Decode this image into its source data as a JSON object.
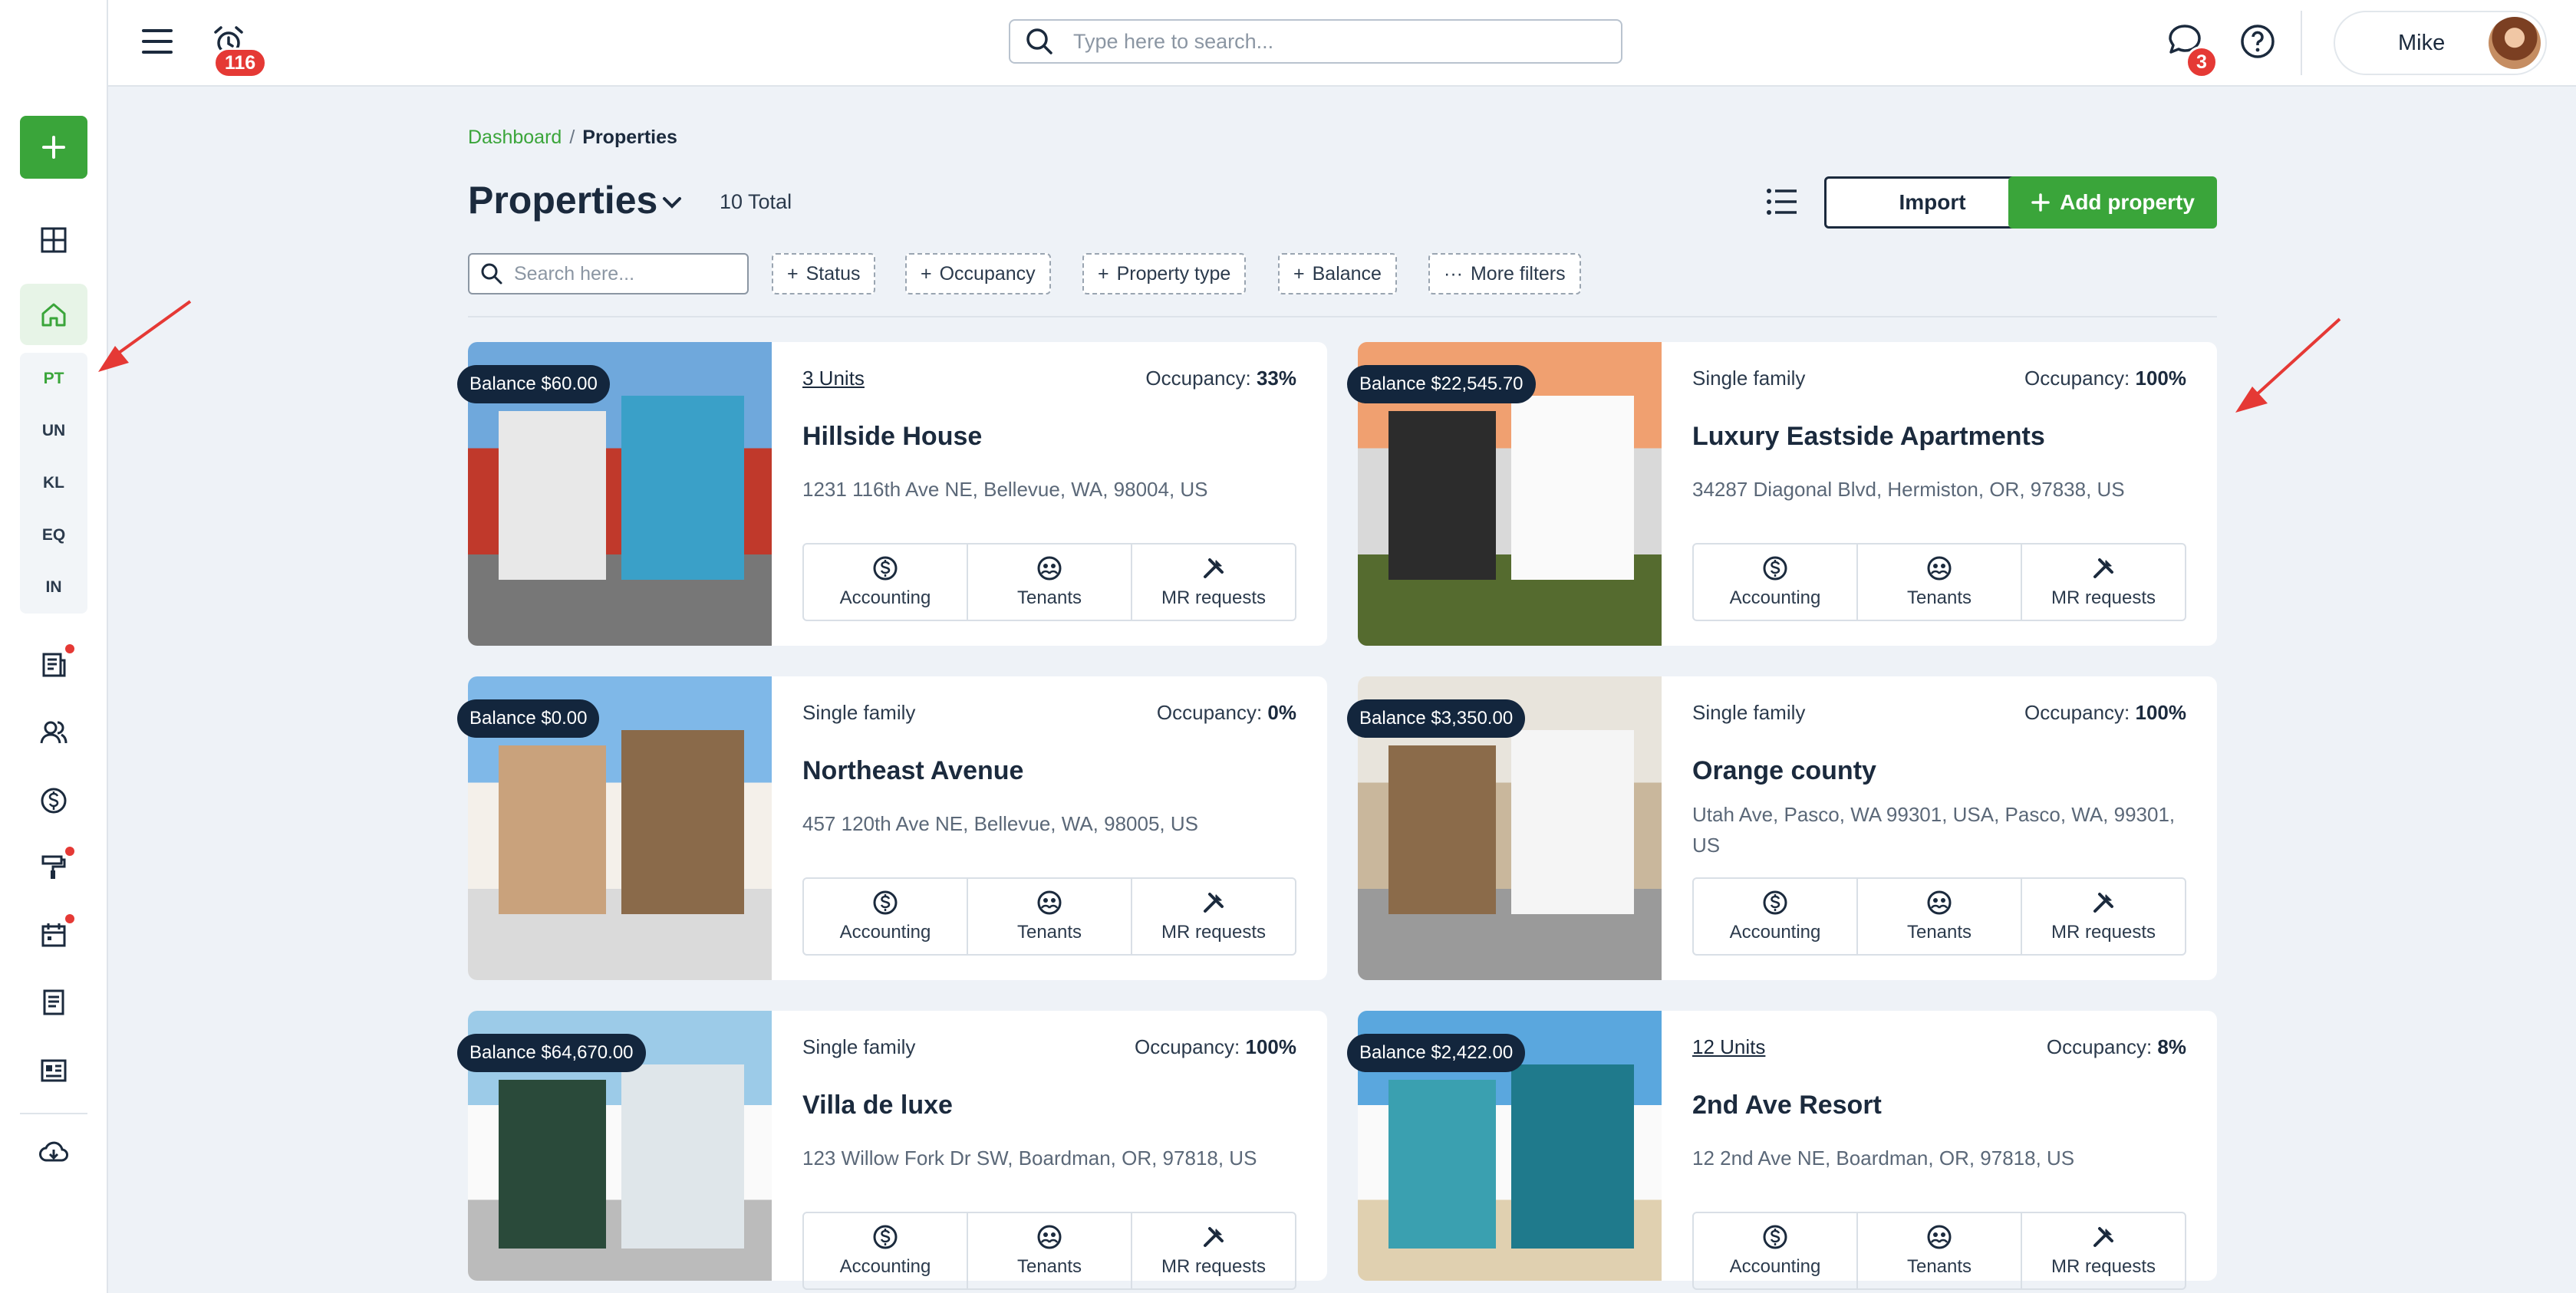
{
  "topbar": {
    "notifications_count": "116",
    "search_placeholder": "Type here to search...",
    "messages_count": "3",
    "user_name": "Mike"
  },
  "sidebar": {
    "sub_items": [
      "PT",
      "UN",
      "KL",
      "EQ",
      "IN"
    ]
  },
  "breadcrumb": {
    "root": "Dashboard",
    "separator": "/",
    "current": "Properties"
  },
  "page": {
    "title": "Properties",
    "total": "10 Total",
    "import_label": "Import",
    "add_label": "Add property"
  },
  "filters": {
    "search_placeholder": "Search here...",
    "chips": [
      "Status",
      "Occupancy",
      "Property type",
      "Balance",
      "More filters"
    ]
  },
  "action_labels": {
    "accounting": "Accounting",
    "tenants": "Tenants",
    "mr": "MR requests"
  },
  "occupancy_label": "Occupancy:",
  "properties": [
    {
      "balance": "Balance $60.00",
      "type": "3 Units",
      "type_link": true,
      "occupancy": "33%",
      "name": "Hillside House",
      "address": "1231 116th Ave NE, Bellevue, WA, 98004, US"
    },
    {
      "balance": "Balance $22,545.70",
      "type": "Single family",
      "type_link": false,
      "occupancy": "100%",
      "name": "Luxury Eastside Apartments",
      "address": "34287 Diagonal Blvd, Hermiston, OR, 97838, US"
    },
    {
      "balance": "Balance $0.00",
      "type": "Single family",
      "type_link": false,
      "occupancy": "0%",
      "name": "Northeast Avenue",
      "address": "457 120th Ave NE, Bellevue, WA, 98005, US"
    },
    {
      "balance": "Balance $3,350.00",
      "type": "Single family",
      "type_link": false,
      "occupancy": "100%",
      "name": "Orange county",
      "address": "Utah Ave, Pasco, WA 99301, USA, Pasco, WA, 99301, US"
    },
    {
      "balance": "Balance $64,670.00",
      "type": "Single family",
      "type_link": false,
      "occupancy": "100%",
      "name": "Villa de luxe",
      "address": "123 Willow Fork Dr SW, Boardman, OR, 97818, US"
    },
    {
      "balance": "Balance $2,422.00",
      "type": "12 Units",
      "type_link": true,
      "occupancy": "8%",
      "name": "2nd Ave Resort",
      "address": "12 2nd Ave NE, Boardman, OR, 97818, US"
    }
  ],
  "colors": {
    "accent": "#3aa53a",
    "dark": "#13263d",
    "alert": "#e53935"
  }
}
